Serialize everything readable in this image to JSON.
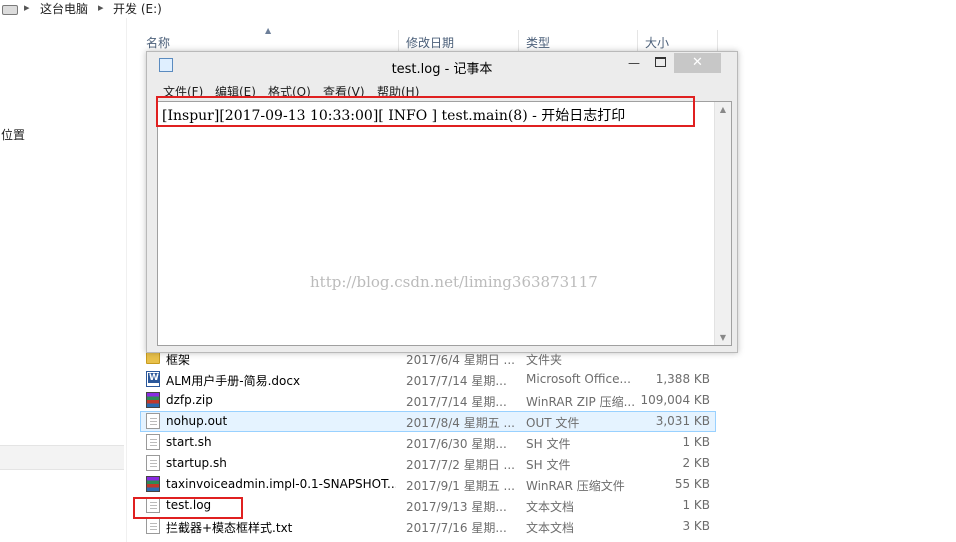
{
  "address_bar": {
    "crumbs": [
      "这台电脑",
      "开发 (E:)"
    ],
    "separator": "▸"
  },
  "nav_pane": {
    "label": "位置"
  },
  "columns": {
    "name": "名称",
    "modified": "修改日期",
    "type": "类型",
    "size": "大小"
  },
  "files": [
    {
      "name": "框架",
      "date": "2017/6/4 星期日 ...",
      "type": "文件夹",
      "size": "",
      "icon": "folder-icon"
    },
    {
      "name": "ALM用户手册-简易.docx",
      "date": "2017/7/14 星期...",
      "type": "Microsoft Office...",
      "size": "1,388 KB",
      "icon": "word-doc-icon"
    },
    {
      "name": "dzfp.zip",
      "date": "2017/7/14 星期...",
      "type": "WinRAR ZIP 压缩...",
      "size": "109,004 KB",
      "icon": "winrar-icon"
    },
    {
      "name": "nohup.out",
      "date": "2017/8/4 星期五 ...",
      "type": "OUT 文件",
      "size": "3,031 KB",
      "icon": "file-icon"
    },
    {
      "name": "start.sh",
      "date": "2017/6/30 星期...",
      "type": "SH 文件",
      "size": "1 KB",
      "icon": "file-icon"
    },
    {
      "name": "startup.sh",
      "date": "2017/7/2 星期日 ...",
      "type": "SH 文件",
      "size": "2 KB",
      "icon": "file-icon"
    },
    {
      "name": "taxinvoiceadmin.impl-0.1-SNAPSHOT....",
      "date": "2017/9/1 星期五 ...",
      "type": "WinRAR 压缩文件",
      "size": "55 KB",
      "icon": "winrar-icon"
    },
    {
      "name": "test.log",
      "date": "2017/9/13 星期...",
      "type": "文本文档",
      "size": "1 KB",
      "icon": "text-file-icon"
    },
    {
      "name": "拦截器+模态框样式.txt",
      "date": "2017/7/16 星期...",
      "type": "文本文档",
      "size": "3 KB",
      "icon": "text-file-icon"
    }
  ],
  "notepad": {
    "title": "test.log - 记事本",
    "menu": [
      "文件(F)",
      "编辑(E)",
      "格式(O)",
      "查看(V)",
      "帮助(H)"
    ],
    "content": "[Inspur][2017-09-13 10:33:00][ INFO ] test.main(8) - 开始日志打印",
    "watermark": "http://blog.csdn.net/liming363873117",
    "controls": {
      "minimize": "—",
      "close": "✕"
    }
  },
  "colors": {
    "highlight_border": "#e02020",
    "hover_row_bg": "#e5f3ff",
    "hover_row_border": "#99d1ff"
  }
}
